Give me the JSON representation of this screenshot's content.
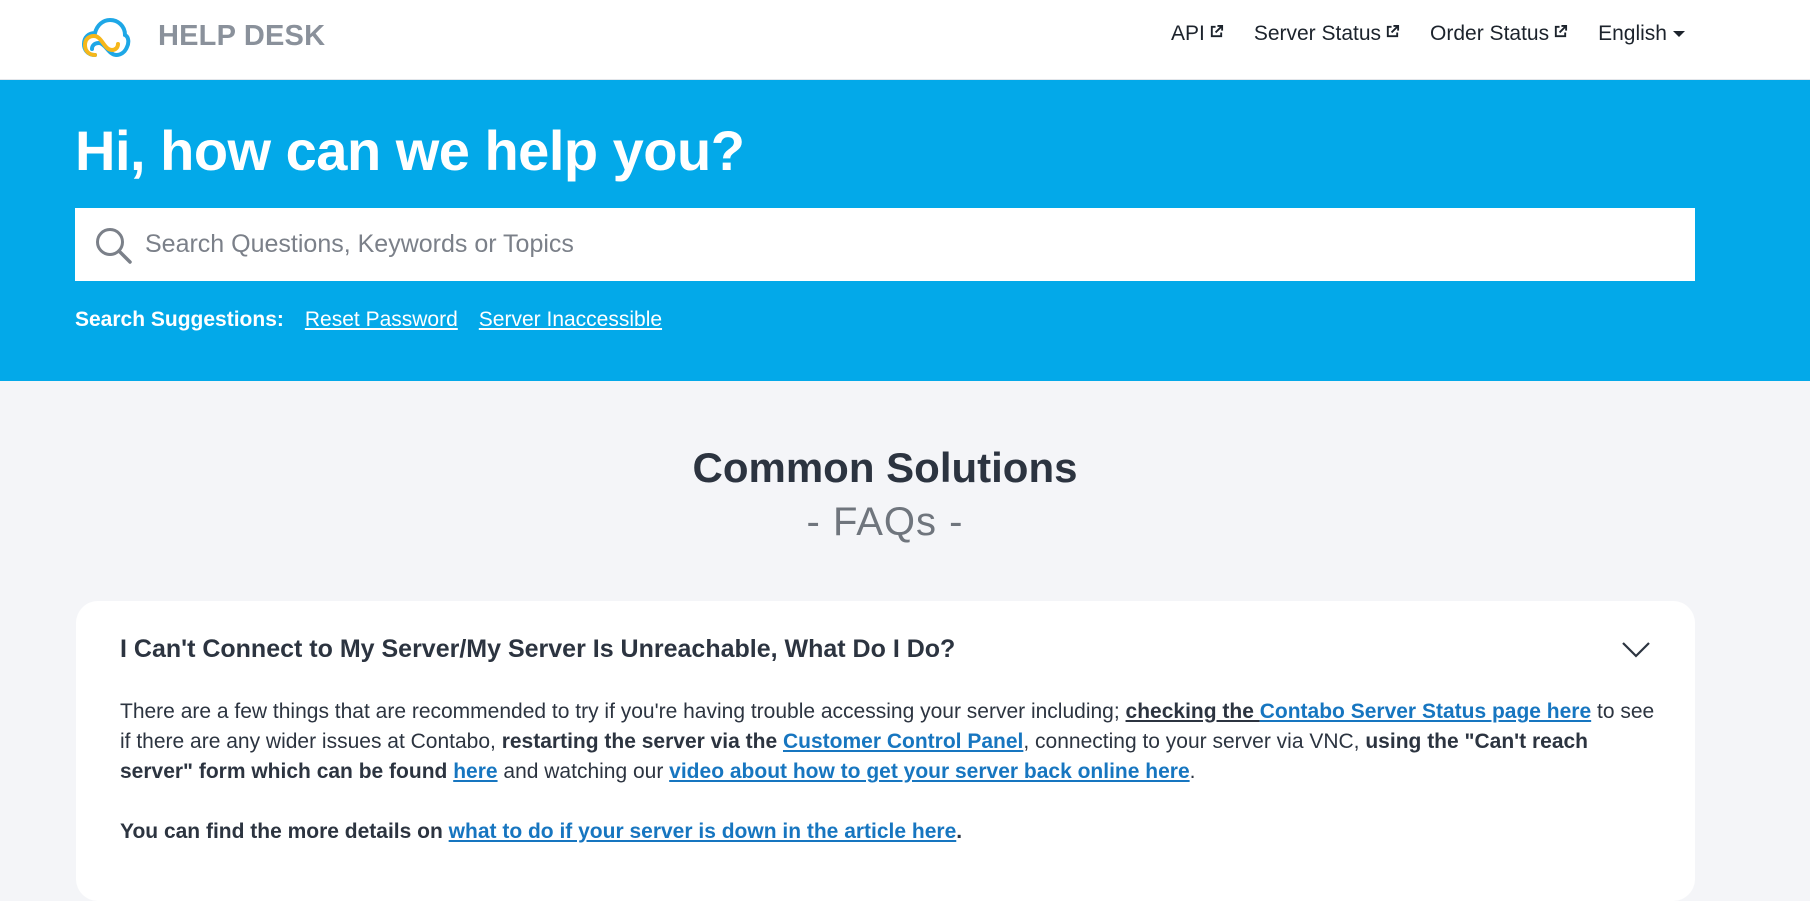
{
  "header": {
    "brand": "HELP DESK",
    "nav": {
      "api": "API",
      "server_status": "Server Status",
      "order_status": "Order Status",
      "language": "English"
    }
  },
  "hero": {
    "title": "Hi, how can we help you?",
    "search_placeholder": "Search Questions, Keywords or Topics",
    "suggestions_label": "Search Suggestions:",
    "suggestions": [
      "Reset Password",
      "Server Inaccessible"
    ]
  },
  "faq_section": {
    "title": "Common Solutions",
    "subtitle": "- FAQs -"
  },
  "faq": {
    "question": "I Can't Connect to My Server/My Server Is Unreachable, What Do I Do?",
    "p1": {
      "t1": "There are a few things that are recommended to try if you're having trouble accessing your server including; ",
      "b1": "checking the ",
      "l1": "Contabo Server Status page here",
      "t2": " to see if there are any wider issues at Contabo, ",
      "b2": "restarting the server via the ",
      "l2": "Customer Control Panel",
      "t3": ", connecting to your server via VNC, ",
      "b3": "using the \"Can't reach server\" form which can be found ",
      "l3": "here",
      "t4": " and watching our ",
      "l4": "video about how to get your server back online here",
      "t5": "."
    },
    "p2": {
      "b1": "You can find the more details on ",
      "l1": "what to do if your server is down in the article here",
      "t1": "."
    }
  },
  "colors": {
    "hero_bg": "#03a9e9",
    "page_bg": "#f4f5f8",
    "link": "#1776c0",
    "logo_blue": "#1ea7e6",
    "logo_yellow": "#f6b71a"
  },
  "icons": [
    "cloud-logo-icon",
    "external-link-icon",
    "caret-down-icon",
    "search-icon",
    "chevron-down-icon"
  ]
}
